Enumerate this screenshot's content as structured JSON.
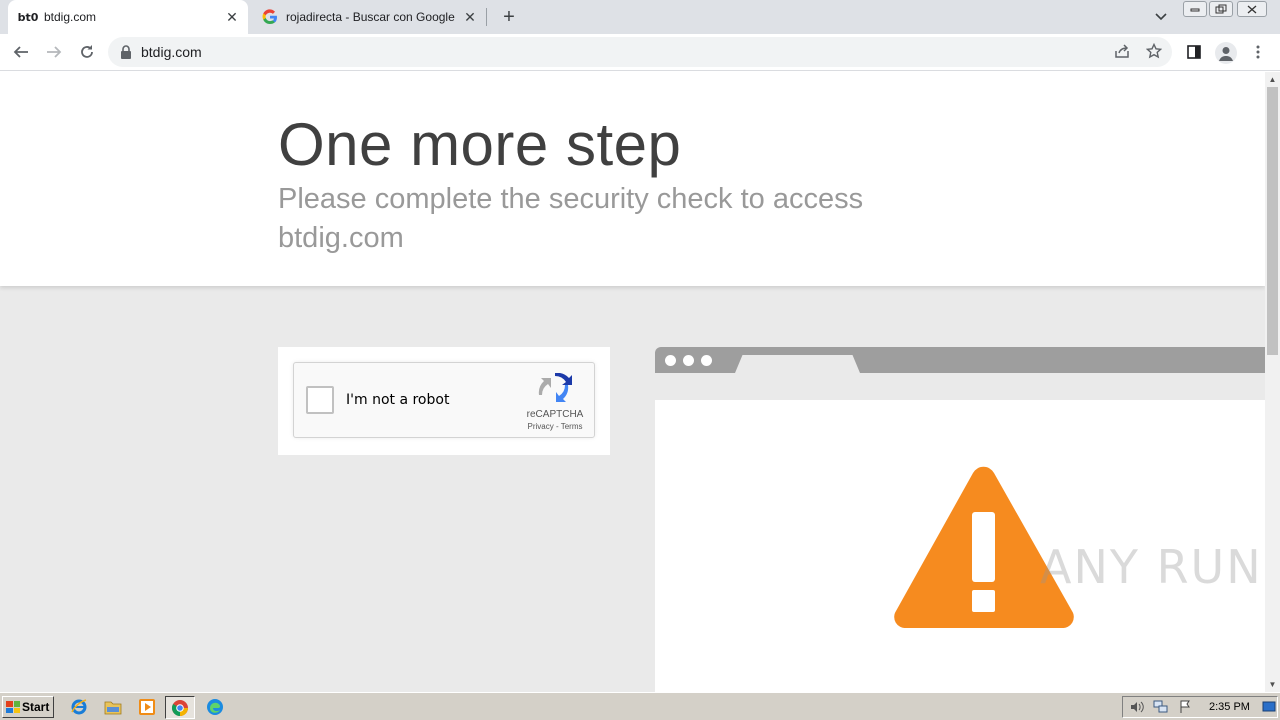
{
  "browser": {
    "tabs": [
      {
        "favicon_text": "bt0",
        "title": "btdig.com",
        "close": "✕"
      },
      {
        "favicon_text": "G",
        "title": "rojadirecta - Buscar con Google",
        "close": "✕"
      }
    ],
    "new_tab": "+",
    "url": "btdig.com"
  },
  "page": {
    "headline": "One more step",
    "subheadline": "Please complete the security check to access btdig.com"
  },
  "recaptcha": {
    "label": "I'm not a robot",
    "brand": "reCAPTCHA",
    "links": "Privacy - Terms",
    "checked": false
  },
  "illustration": {
    "warning_color": "#f68b1f"
  },
  "watermark": "ANY RUN",
  "taskbar": {
    "start_label": "Start",
    "clock": "2:35 PM"
  },
  "icons": [
    "back-arrow-icon",
    "forward-arrow-icon",
    "reload-icon",
    "lock-icon",
    "share-icon",
    "star-icon",
    "side-panel-icon",
    "profile-icon",
    "menu-dots-icon",
    "windows-flag-icon",
    "ie-icon",
    "folder-icon",
    "media-player-icon",
    "chrome-icon",
    "edge-icon",
    "speaker-icon",
    "network-icon",
    "flag-icon",
    "show-desktop-icon"
  ]
}
